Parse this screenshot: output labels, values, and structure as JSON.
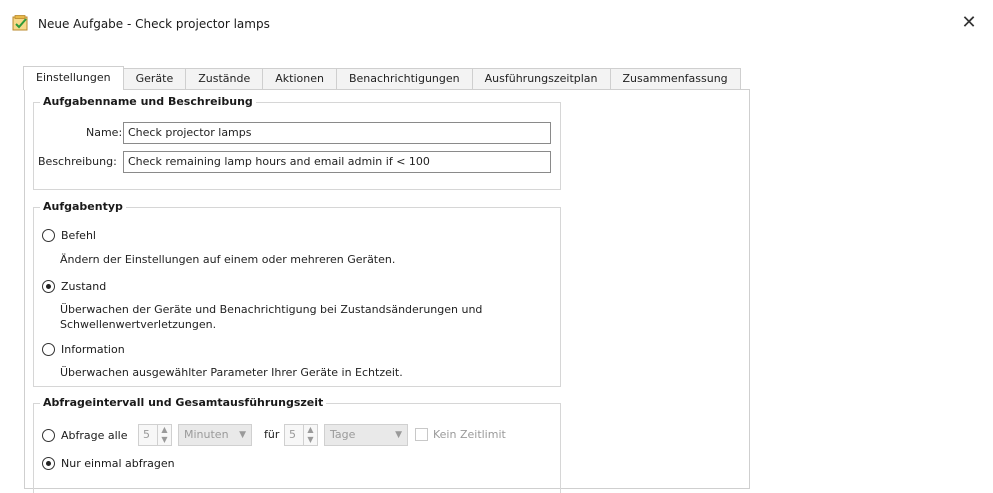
{
  "window": {
    "title": "Neue Aufgabe - Check projector lamps",
    "icon": "app-task-icon",
    "close_label": "✕"
  },
  "tabs": [
    {
      "label": "Einstellungen",
      "active": true
    },
    {
      "label": "Geräte"
    },
    {
      "label": "Zustände"
    },
    {
      "label": "Aktionen"
    },
    {
      "label": "Benachrichtigungen"
    },
    {
      "label": "Ausführungszeitplan"
    },
    {
      "label": "Zusammenfassung"
    }
  ],
  "name_group": {
    "title": "Aufgabenname und Beschreibung",
    "name_label": "Name:",
    "name_value": "Check projector lamps",
    "desc_label": "Beschreibung:",
    "desc_value": "Check remaining lamp hours and email admin if < 100"
  },
  "type_group": {
    "title": "Aufgabentyp",
    "options": [
      {
        "label": "Befehl",
        "checked": false,
        "description": "Ändern der Einstellungen auf einem oder mehreren Geräten."
      },
      {
        "label": "Zustand",
        "checked": true,
        "description_line1": "Überwachen der Geräte und Benachrichtigung bei Zustandsänderungen und",
        "description_line2": "Schwellenwertverletzungen."
      },
      {
        "label": "Information",
        "checked": false,
        "description": "Überwachen ausgewählter Parameter Ihrer Geräte in Echtzeit."
      }
    ]
  },
  "interval_group": {
    "title": "Abfrageintervall und Gesamtausführungszeit",
    "poll_every_label": "Abfrage alle",
    "poll_every_value": "5",
    "poll_unit": "Minuten",
    "for_label": "für",
    "for_value": "5",
    "for_unit": "Tage",
    "no_limit_label": "Kein Zeitlimit",
    "once_label": "Nur einmal abfragen",
    "poll_every_checked": false,
    "once_checked": true
  }
}
